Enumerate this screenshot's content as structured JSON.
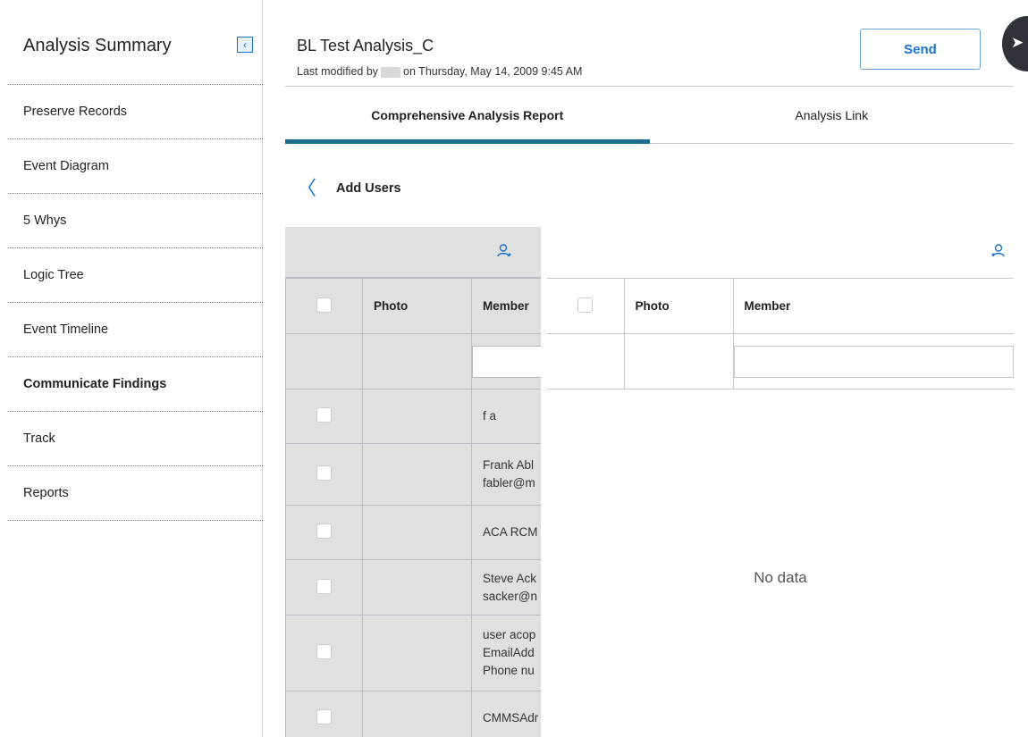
{
  "sidebar": {
    "title": "Analysis Summary",
    "collapse_icon": "chevron-left-icon",
    "items": [
      {
        "label": "Preserve Records"
      },
      {
        "label": "Event Diagram"
      },
      {
        "label": "5 Whys"
      },
      {
        "label": "Logic Tree"
      },
      {
        "label": "Event Timeline"
      },
      {
        "label": "Communicate Findings",
        "active": true
      },
      {
        "label": "Track"
      },
      {
        "label": "Reports"
      }
    ]
  },
  "header": {
    "title": "BL Test Analysis_C",
    "modified_prefix": "Last modified by",
    "modified_suffix": "on Thursday, May 14, 2009 9:45 AM",
    "send_label": "Send",
    "side_toggle_icon": "panel-toggle-icon"
  },
  "tabs": [
    {
      "label": "Comprehensive Analysis Report",
      "active": true
    },
    {
      "label": "Analysis Link"
    }
  ],
  "back": {
    "label": "Add Users",
    "icon": "chevron-left-icon"
  },
  "available_users": {
    "toolbar_icon": "user-add-icon",
    "columns": [
      "Photo",
      "Member"
    ],
    "rows": [
      {
        "member_lines": [
          "f a"
        ]
      },
      {
        "member_lines": [
          "Frank Abl",
          "fabler@m"
        ]
      },
      {
        "member_lines": [
          "ACA RCM"
        ]
      },
      {
        "member_lines": [
          "Steve Ack",
          "sacker@n"
        ]
      },
      {
        "member_lines": [
          "user acop",
          "EmailAdd",
          "Phone nu"
        ]
      },
      {
        "member_lines": [
          "CMMSAdr"
        ]
      }
    ]
  },
  "selected_users": {
    "toolbar_icon": "user-remove-icon",
    "columns": [
      "Photo",
      "Member"
    ],
    "empty_text": "No data"
  },
  "colors": {
    "accent": "#1a73d0",
    "tab_indicator": "#1b6f8c",
    "left_grid_bg": "#e0e0e0"
  }
}
